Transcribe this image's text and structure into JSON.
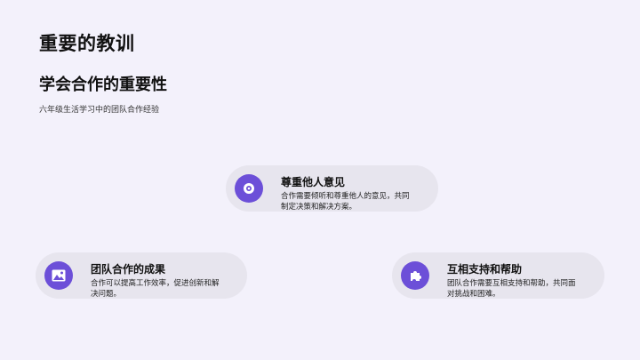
{
  "slide": {
    "title": "重要的教训",
    "subtitle": "学会合作的重要性",
    "description": "六年级生活学习中的团队合作经验"
  },
  "cards": {
    "respect": {
      "icon": "eye-icon",
      "title": "尊重他人意见",
      "body_line1": "合作需要倾听和尊重他人的意见，共同",
      "body_line2": "制定决策和解决方案。"
    },
    "outcome": {
      "icon": "image-icon",
      "title": "团队合作的成果",
      "body_line1": "合作可以提高工作效率，促进创新和解",
      "body_line2": "决问题。"
    },
    "support": {
      "icon": "puzzle-icon",
      "title": "互相支持和帮助",
      "body_line1": "团队合作需要互相支持和帮助，共同面",
      "body_line2": "对挑战和困难。"
    }
  },
  "colors": {
    "accent": "#6c4fd8",
    "card_bg": "#e7e5ee",
    "page_bg": "#f3f1fb"
  }
}
